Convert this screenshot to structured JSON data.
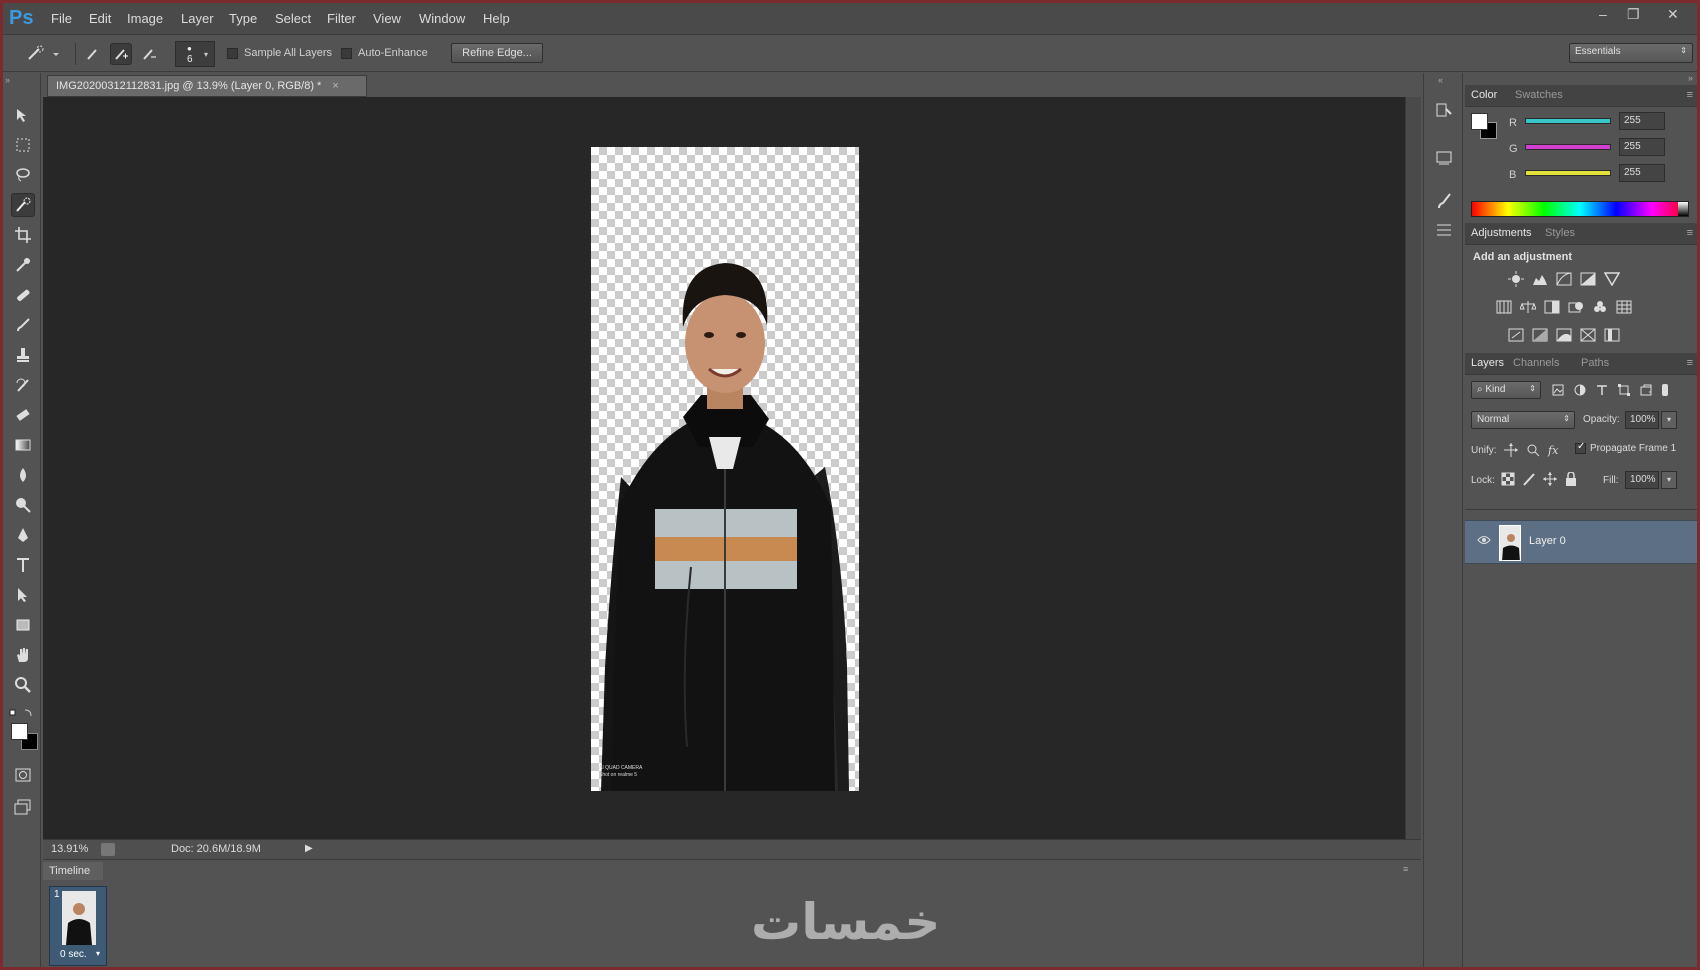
{
  "app": {
    "logo": "Ps"
  },
  "menu": [
    "File",
    "Edit",
    "Image",
    "Layer",
    "Type",
    "Select",
    "Filter",
    "View",
    "Window",
    "Help"
  ],
  "window_controls": {
    "minimize": "–",
    "restore": "❐",
    "close": "✕"
  },
  "options": {
    "brush_size": "6",
    "sample_all_layers": "Sample All Layers",
    "auto_enhance": "Auto-Enhance",
    "refine_edge": "Refine Edge...",
    "workspace": "Essentials"
  },
  "document": {
    "tab_title": "IMG20200312112831.jpg @ 13.9% (Layer 0, RGB/8) *",
    "close": "×",
    "photo_caption_line1": "AI QUAD CAMERA",
    "photo_caption_line2": "Shot on realme 5"
  },
  "status": {
    "zoom": "13.91%",
    "doc": "Doc: 20.6M/18.9M"
  },
  "timeline": {
    "tab": "Timeline",
    "frame_number": "1",
    "frame_delay": "0 sec."
  },
  "color_panel": {
    "tabs": [
      "Color",
      "Swatches"
    ],
    "channels": [
      {
        "label": "R",
        "value": "255",
        "color": "#38c6c8"
      },
      {
        "label": "G",
        "value": "255",
        "color": "#d23fd0"
      },
      {
        "label": "B",
        "value": "255",
        "color": "#e2e23a"
      }
    ]
  },
  "adjustments_panel": {
    "tabs": [
      "Adjustments",
      "Styles"
    ],
    "heading": "Add an adjustment"
  },
  "layers_panel": {
    "tabs": [
      "Layers",
      "Channels",
      "Paths"
    ],
    "filter": "Kind",
    "blend_mode": "Normal",
    "opacity_label": "Opacity:",
    "opacity": "100%",
    "unify_label": "Unify:",
    "propagate": "Propagate Frame 1",
    "lock_label": "Lock:",
    "fill_label": "Fill:",
    "fill": "100%",
    "layers": [
      {
        "name": "Layer 0",
        "visible": true,
        "selected": true
      }
    ]
  },
  "watermark": "خمسات"
}
